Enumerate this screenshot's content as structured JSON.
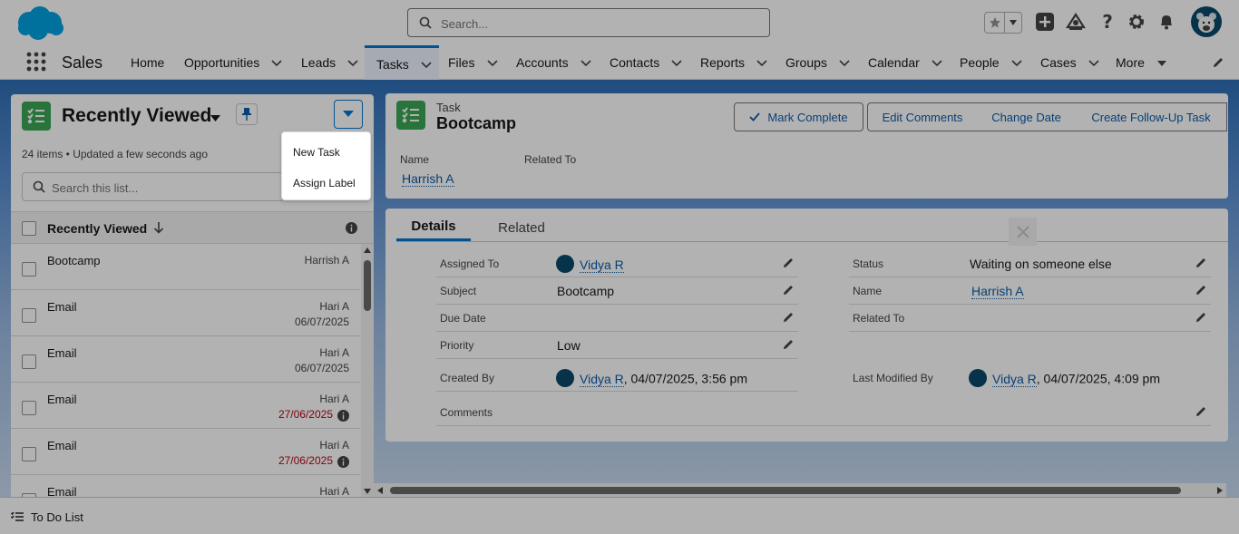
{
  "header": {
    "search_placeholder": "Search...",
    "icons": [
      "salesforce-cloud-icon",
      "search-icon",
      "favorites-star-icon",
      "favorites-list-icon",
      "global-actions-plus-icon",
      "trailhead-icon",
      "help-icon",
      "setup-gear-icon",
      "notifications-bell-icon",
      "user-avatar"
    ]
  },
  "nav": {
    "app_name": "Sales",
    "tabs": [
      {
        "label": "Home"
      },
      {
        "label": "Opportunities"
      },
      {
        "label": "Leads"
      },
      {
        "label": "Tasks",
        "active": true
      },
      {
        "label": "Files"
      },
      {
        "label": "Accounts"
      },
      {
        "label": "Contacts"
      },
      {
        "label": "Reports"
      },
      {
        "label": "Groups"
      },
      {
        "label": "Calendar"
      },
      {
        "label": "People"
      },
      {
        "label": "Cases"
      },
      {
        "label": "More"
      }
    ]
  },
  "list_panel": {
    "title": "Recently Viewed",
    "meta": "24 items • Updated a few seconds ago",
    "search_placeholder": "Search this list...",
    "column_header": "Recently Viewed",
    "rows": [
      {
        "subject": "Bootcamp",
        "who": "Harrish A",
        "date": "",
        "overdue": false
      },
      {
        "subject": "Email",
        "who": "Hari A",
        "date": "06/07/2025",
        "overdue": false
      },
      {
        "subject": "Email",
        "who": "Hari A",
        "date": "06/07/2025",
        "overdue": false
      },
      {
        "subject": "Email",
        "who": "Hari A",
        "date": "27/06/2025",
        "overdue": true
      },
      {
        "subject": "Email",
        "who": "Hari A",
        "date": "27/06/2025",
        "overdue": true
      },
      {
        "subject": "Email",
        "who": "Hari A",
        "date": "",
        "overdue": false
      }
    ]
  },
  "dropdown_menu": {
    "new_task": "New Task",
    "assign_label": "Assign Label"
  },
  "record": {
    "type": "Task",
    "name": "Bootcamp",
    "buttons": {
      "mark_complete": "Mark Complete",
      "edit_comments": "Edit Comments",
      "change_date": "Change Date",
      "create_follow_up": "Create Follow-Up Task"
    },
    "highlights": {
      "name_label": "Name",
      "name_value": "Harrish A",
      "related_label": "Related To"
    }
  },
  "details": {
    "tabs": {
      "details": "Details",
      "related": "Related"
    },
    "fields": {
      "assigned_to": {
        "label": "Assigned To",
        "value": "Vidya R"
      },
      "subject": {
        "label": "Subject",
        "value": "Bootcamp"
      },
      "due_date": {
        "label": "Due Date",
        "value": ""
      },
      "priority": {
        "label": "Priority",
        "value": "Low"
      },
      "created_by": {
        "label": "Created By",
        "user": "Vidya R",
        "stamp": ", 04/07/2025, 3:56 pm"
      },
      "comments": {
        "label": "Comments",
        "value": ""
      },
      "status": {
        "label": "Status",
        "value": "Waiting on someone else"
      },
      "name": {
        "label": "Name",
        "value": "Harrish A"
      },
      "related_to": {
        "label": "Related To",
        "value": ""
      },
      "last_modified_by": {
        "label": "Last Modified By",
        "user": "Vidya R",
        "stamp": ", 04/07/2025, 4:09 pm"
      }
    }
  },
  "footer": {
    "todo_label": "To Do List"
  },
  "colors": {
    "brand_blue": "#0176d3",
    "link_blue": "#0b5cab",
    "task_green": "#3ba755",
    "overdue_red": "#ba0517"
  }
}
